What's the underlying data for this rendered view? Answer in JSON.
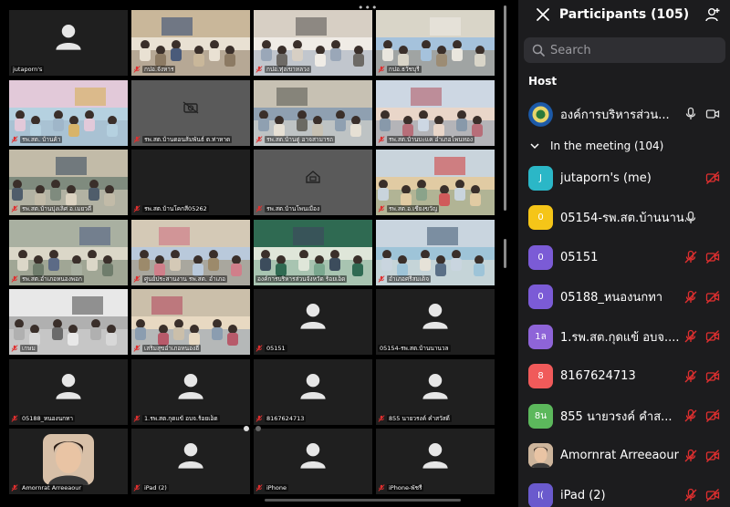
{
  "grid": {
    "tiles": [
      {
        "label": "jutaporn's",
        "kind": "avatar",
        "muted": false
      },
      {
        "label": "กปอ.จังหาร",
        "kind": "video",
        "scene": 1,
        "muted": true
      },
      {
        "label": "กปอ.ทุ่งเขาหลวง",
        "kind": "video",
        "scene": 2,
        "muted": true
      },
      {
        "label": "กปอ.ธวัชบุรี",
        "kind": "video",
        "scene": 3,
        "muted": true
      },
      {
        "label": "รพ.สต. บ้านค้า",
        "kind": "video",
        "scene": 4,
        "muted": true
      },
      {
        "label": "รพ.สต.บ้านดอนส้มพันธ์ ต.ท่าหาด",
        "kind": "camoff",
        "muted": true
      },
      {
        "label": "รพ.สต.บ้านดู่ อาจสามารถ",
        "kind": "video",
        "scene": 5,
        "muted": true
      },
      {
        "label": "รพ.สต.บ้านบะแค อำเภอโพนทอง",
        "kind": "video",
        "scene": 6,
        "muted": true
      },
      {
        "label": "รพ.สต.บ้านบุ่งเลิศ อ.เมยวดี",
        "kind": "video",
        "scene": 7,
        "muted": true
      },
      {
        "label": "รพ.สต.บ้านโคกสี05262",
        "kind": "blank",
        "muted": true
      },
      {
        "label": "รพ.สต.บ้านโพนเมือง",
        "kind": "camoff2",
        "muted": true
      },
      {
        "label": "รพ.สต.อ.เชียงขวัญ",
        "kind": "video",
        "scene": 8,
        "muted": true
      },
      {
        "label": "รพ.สต.อำเภอหนองพอก",
        "kind": "video",
        "scene": 9,
        "muted": true
      },
      {
        "label": "ศูนย์ประสานงาน รพ.สต. อำเภอ",
        "kind": "video",
        "scene": 10,
        "muted": true
      },
      {
        "label": "องค์การบริหารส่วนจังหวัด ร้อยเอ็ด",
        "kind": "video",
        "scene": 11,
        "muted": false,
        "active": true
      },
      {
        "label": "อำเภอศรีสมเด็จ",
        "kind": "video",
        "scene": 12,
        "muted": true
      },
      {
        "label": "เกษม",
        "kind": "video",
        "scene": 13,
        "muted": true
      },
      {
        "label": "เสริมสุขอำเภอหนองฮี",
        "kind": "video",
        "scene": 14,
        "muted": true
      },
      {
        "label": "05151",
        "kind": "avatar",
        "muted": true
      },
      {
        "label": "05154-รพ.สต.บ้านนานวล",
        "kind": "avatar",
        "muted": false
      },
      {
        "label": "05188_หนองนกทา",
        "kind": "avatar",
        "muted": true
      },
      {
        "label": "1.รพ.สต.กุดแข้ อบจ.ร้อยเอ็ด",
        "kind": "avatar",
        "muted": true
      },
      {
        "label": "8167624713",
        "kind": "avatar",
        "muted": true
      },
      {
        "label": "855 นายวรงค์ คำสวัสดิ์",
        "kind": "avatar",
        "muted": true
      },
      {
        "label": "Amornrat Arreeaour",
        "kind": "photo",
        "muted": true
      },
      {
        "label": "iPad (2)",
        "kind": "avatar",
        "muted": true
      },
      {
        "label": "iPhone",
        "kind": "avatar",
        "muted": true
      },
      {
        "label": "iPhone-พัชรี",
        "kind": "avatar",
        "muted": true
      }
    ]
  },
  "panel": {
    "title": "Participants (105)",
    "search_placeholder": "Search",
    "host_heading": "Host",
    "host": {
      "name": "องค์การบริหารส่วน...",
      "mic": "on",
      "cam": "on"
    },
    "meeting_heading": "In the meeting (104)",
    "participants": [
      {
        "initials": "J",
        "color": "#2bb7c7",
        "name": "jutaporn's (me)",
        "mic": "none",
        "cam": "off"
      },
      {
        "initials": "0",
        "color": "#f5c518",
        "name": "05154-รพ.สต.บ้านนาน...",
        "mic": "on",
        "cam": "none"
      },
      {
        "initials": "0",
        "color": "#7b5bd6",
        "name": "05151",
        "mic": "off",
        "cam": "off"
      },
      {
        "initials": "0",
        "color": "#7b5bd6",
        "name": "05188_หนองนกทา",
        "mic": "off",
        "cam": "off"
      },
      {
        "initials": "1ล",
        "color": "#8e64d8",
        "name": "1.รพ.สต.กุดแข้ อบจ....",
        "mic": "off",
        "cam": "off"
      },
      {
        "initials": "8",
        "color": "#f05a5a",
        "name": "8167624713",
        "mic": "off",
        "cam": "off"
      },
      {
        "initials": "8น",
        "color": "#5cb85c",
        "name": "855 นายวรงค์ คำส...",
        "mic": "off",
        "cam": "off"
      },
      {
        "initials": "",
        "color": "#c99a7a",
        "name": "Amornrat Arreeaour",
        "mic": "off",
        "cam": "off",
        "photo": true
      },
      {
        "initials": "I(",
        "color": "#6a5acd",
        "name": "iPad (2)",
        "mic": "off",
        "cam": "off"
      }
    ]
  },
  "colors": {
    "accent_green": "#34d058",
    "mute_red": "#e02f2f",
    "panel_bg": "#1c1c1e"
  }
}
